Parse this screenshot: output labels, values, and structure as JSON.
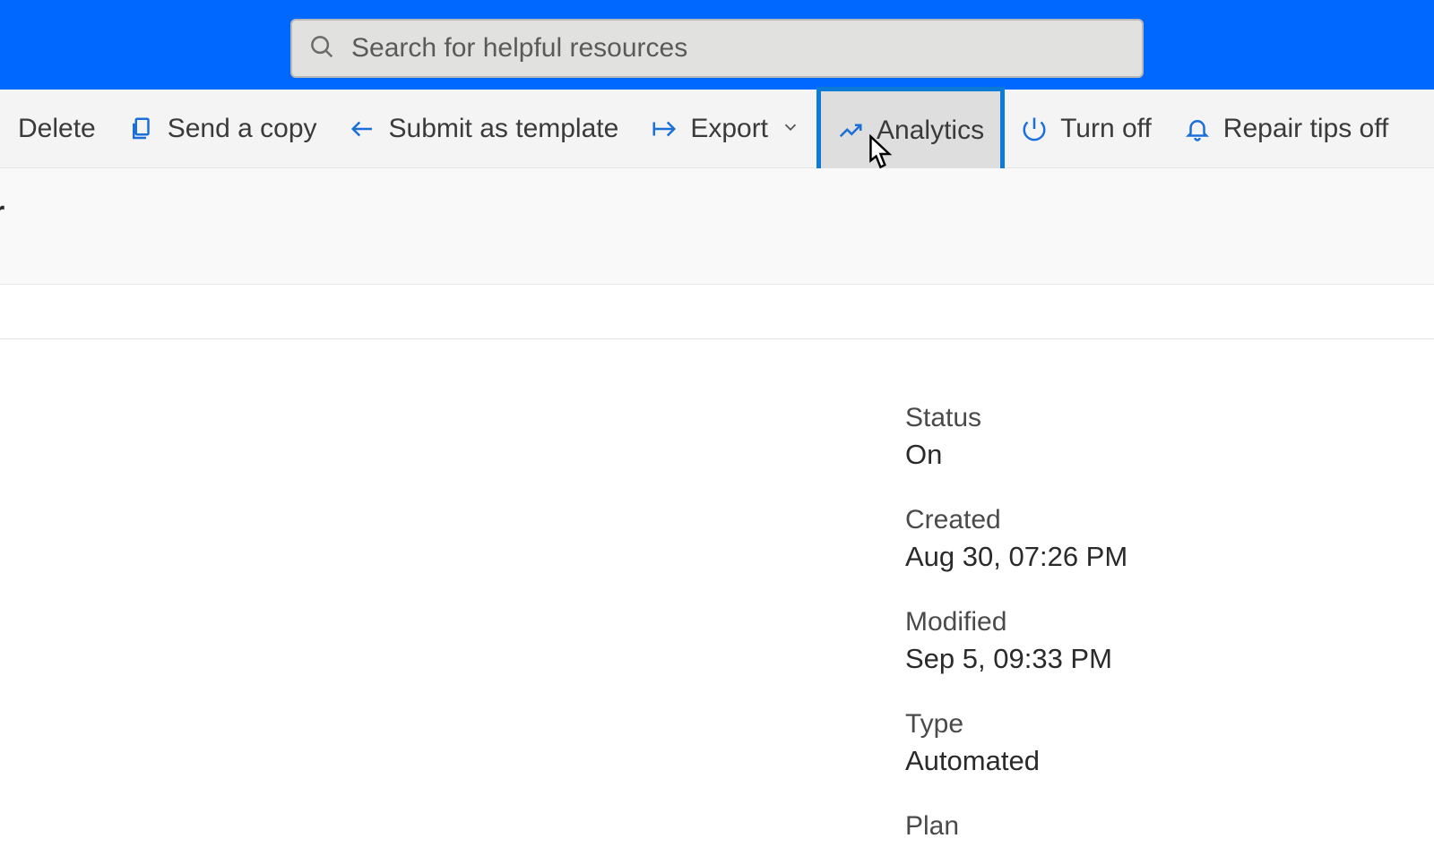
{
  "search": {
    "placeholder": "Search for helpful resources"
  },
  "commands": {
    "delete": "Delete",
    "send_copy": "Send a copy",
    "submit_template": "Submit as template",
    "export": "Export",
    "analytics": "Analytics",
    "turn_off": "Turn off",
    "repair_tips_off": "Repair tips off"
  },
  "title_fragment": "r",
  "details": {
    "status": {
      "label": "Status",
      "value": "On"
    },
    "created": {
      "label": "Created",
      "value": "Aug 30, 07:26 PM"
    },
    "modified": {
      "label": "Modified",
      "value": "Sep 5, 09:33 PM"
    },
    "type": {
      "label": "Type",
      "value": "Automated"
    },
    "plan": {
      "label": "Plan",
      "value": ""
    }
  }
}
